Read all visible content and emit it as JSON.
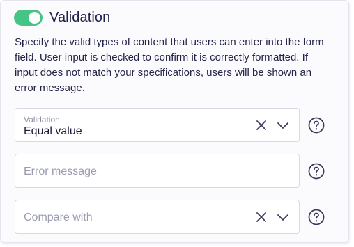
{
  "header": {
    "title": "Validation",
    "toggle_on": true
  },
  "description": "Specify the valid types of content that users can enter into the form field. User input is checked to confirm it is correctly formatted. If input does not match your specifications, users will be shown an error message.",
  "fields": {
    "validation": {
      "label": "Validation",
      "value": "Equal value"
    },
    "error_message": {
      "placeholder": "Error message"
    },
    "compare_with": {
      "placeholder": "Compare with"
    }
  },
  "icons": {
    "clear": "close-icon",
    "dropdown": "chevron-down-icon",
    "help": "question-circle-icon"
  },
  "colors": {
    "toggle": "#46c486",
    "text": "#24244a",
    "border": "#d7d9e4",
    "placeholder": "#9a9cb0"
  }
}
